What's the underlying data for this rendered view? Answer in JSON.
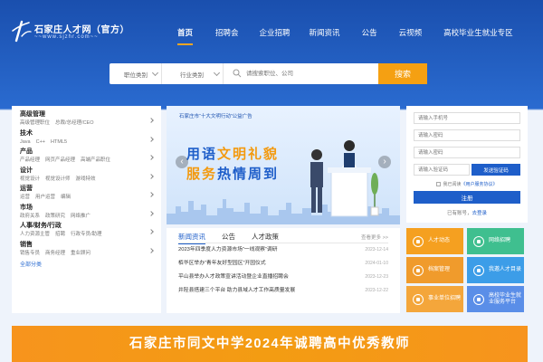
{
  "header": {
    "logo_title": "石家庄人才网（官方）",
    "logo_url": "~~www.sjzhr.com~~",
    "nav": [
      "首页",
      "招聘会",
      "企业招聘",
      "新闻资讯",
      "公告",
      "云视频",
      "高校毕业生就业专区"
    ]
  },
  "search": {
    "select_job": "职位类别",
    "select_industry": "行业类别",
    "placeholder": "请搜索职位、公司",
    "button": "搜索"
  },
  "categories": [
    {
      "title": "高级管理",
      "items": [
        "高级管理职位",
        "总裁/总经理/CEO"
      ]
    },
    {
      "title": "技术",
      "items": [
        "Java",
        "C++",
        "HTML5"
      ]
    },
    {
      "title": "产品",
      "items": [
        "产品经理",
        "网页产品经理",
        "高端产品职位"
      ]
    },
    {
      "title": "设计",
      "items": [
        "视觉设计",
        "视觉设计师",
        "游戏特效"
      ]
    },
    {
      "title": "运营",
      "items": [
        "运营",
        "用户运营",
        "编辑"
      ]
    },
    {
      "title": "市场",
      "items": [
        "政府关系",
        "政策研究",
        "网络推广"
      ]
    },
    {
      "title": "人事/财务/行政",
      "items": [
        "人力资源主管",
        "招聘",
        "行政专员/助理"
      ]
    },
    {
      "title": "销售",
      "items": [
        "销售专员",
        "商务经理",
        "重业顾问"
      ]
    }
  ],
  "categories_all": "全部分类",
  "banner": {
    "tag": "石家庄市“十大文明行动”公益广告",
    "line1_a": "用语",
    "line1_b": "文明礼貌",
    "line2_a": "服务",
    "line2_b": "热情周到",
    "prev": "‹",
    "next": "›"
  },
  "news": {
    "tabs": [
      "新闻资讯",
      "公告",
      "人才政策"
    ],
    "more": "查看更多 >>",
    "items": [
      {
        "title": "2023年四季度人力资源市场“一线观察”调研",
        "date": "2023-12-14"
      },
      {
        "title": "栢华区举办“青年友好型园区”开园仪式",
        "date": "2024-01-10"
      },
      {
        "title": "平山县举办人才政策宣讲活动暨企业直播招聘会",
        "date": "2023-12-23"
      },
      {
        "title": "井陉县搭建三个平台 助力县域人才工作高质量发展",
        "date": "2023-12-22"
      }
    ]
  },
  "login": {
    "phone_placeholder": "请输入手机号",
    "password_placeholder": "请输入密码",
    "password2_placeholder": "请输入密码",
    "code_placeholder": "请输入验证码",
    "code_button": "发送验证码",
    "agree_prefix": "我已阅读",
    "agree_link": "《用户服务协议》",
    "register_button": "注册",
    "has_account": "已有账号，",
    "login_link": "去登录"
  },
  "tiles": [
    {
      "label": "人才动态",
      "color": "#f5a020"
    },
    {
      "label": "网络招聘",
      "color": "#3fbf8f"
    },
    {
      "label": "档案管理",
      "color": "#f09b2c"
    },
    {
      "label": "我邀人才目录",
      "color": "#3c9de8"
    },
    {
      "label": "事业单位招聘",
      "color": "#f4a63b"
    },
    {
      "label": "高校毕业生就业服务平台",
      "color": "#5a8ee8"
    }
  ],
  "bottom_banner": "石家庄市同文中学2024年诚聘高中优秀教师"
}
